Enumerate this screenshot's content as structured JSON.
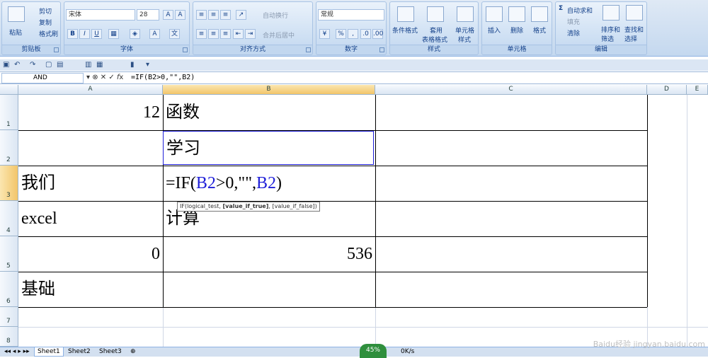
{
  "ribbon": {
    "clipboard": {
      "paste": "粘贴",
      "cut": "剪切",
      "copy": "复制",
      "format_painter": "格式刷",
      "title": "剪贴板"
    },
    "font": {
      "name": "宋体",
      "size": "28",
      "title": "字体"
    },
    "alignment": {
      "wrap": "自动换行",
      "merge": "合并后居中",
      "title": "对齐方式"
    },
    "number": {
      "format": "常规",
      "title": "数字"
    },
    "styles": {
      "conditional": "条件格式",
      "table_fmt_1": "套用",
      "table_fmt_2": "表格格式",
      "cell_style_1": "单元格",
      "cell_style_2": "样式",
      "title": "样式"
    },
    "cells": {
      "insert": "插入",
      "delete": "删除",
      "format": "格式",
      "title": "单元格"
    },
    "editing": {
      "autosum": "自动求和",
      "fill": "填充",
      "clear": "清除",
      "sort_1": "排序和",
      "sort_2": "筛选",
      "find_1": "查找和",
      "find_2": "选择",
      "title": "编辑"
    }
  },
  "formula_bar": {
    "name_box": "AND",
    "formula": "=IF(B2>0,\"\",B2)"
  },
  "columns": [
    "A",
    "B",
    "C",
    "D",
    "E"
  ],
  "rows": [
    "1",
    "2",
    "3",
    "4",
    "5",
    "6",
    "7",
    "8"
  ],
  "cells": {
    "A1": "12",
    "B1": "函数",
    "B2": "学习",
    "A3": "我们",
    "B3_prefix": "=IF(",
    "B3_ref1": "B2",
    "B3_mid": ">0,\"\",",
    "B3_ref2": "B2",
    "B3_suffix": ")",
    "A4": "excel",
    "B4": "计算",
    "A5": "0",
    "B5": "536",
    "A6": "基础"
  },
  "tooltip": {
    "fn": "IF(logical_test, ",
    "bold": "[value_if_true]",
    "rest": ", [value_if_false])"
  },
  "sheets": [
    "Sheet1",
    "Sheet2",
    "Sheet3"
  ],
  "status": {
    "percent": "45%",
    "speed": "0K/s"
  },
  "watermark": "Baidu经验 jingyan.baidu.com"
}
